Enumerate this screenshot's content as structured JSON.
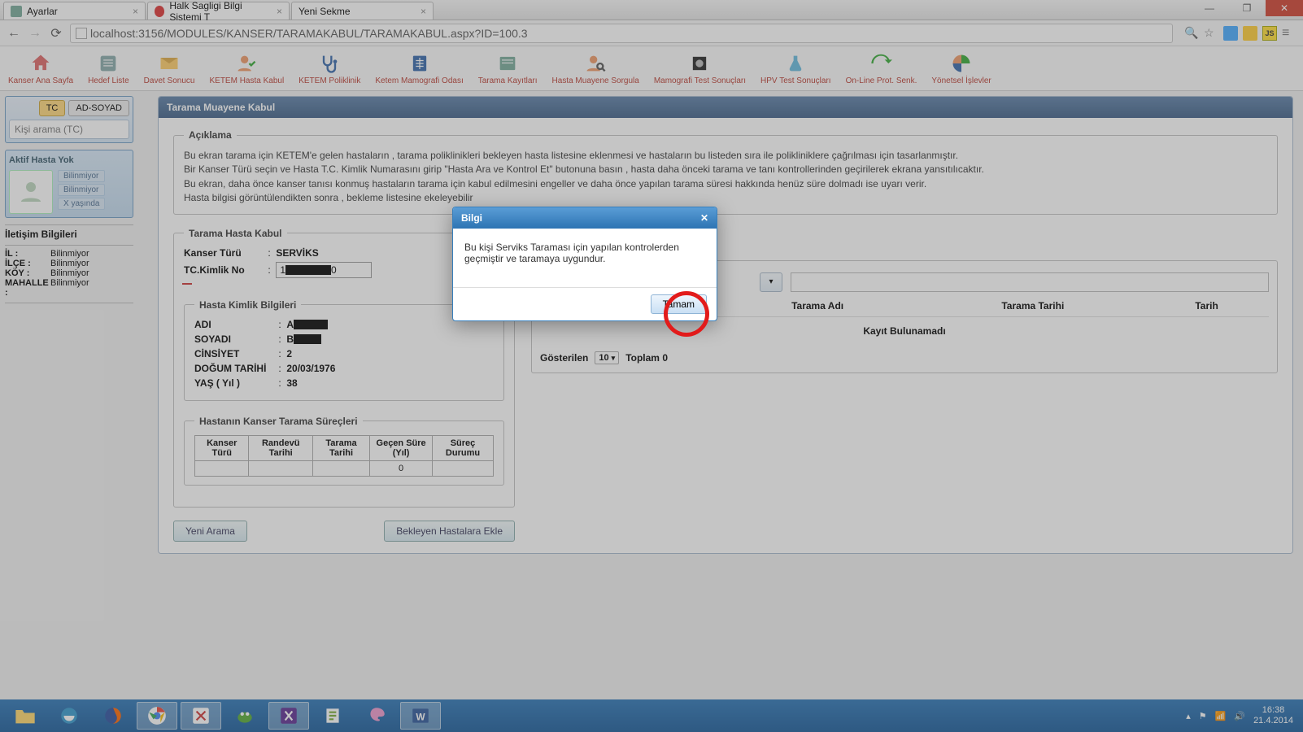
{
  "browser": {
    "tabs": [
      {
        "label": "Ayarlar"
      },
      {
        "label": "Halk Sagligi Bilgi Sistemi T"
      },
      {
        "label": "Yeni Sekme"
      }
    ],
    "active_tab_index": 1,
    "url": "localhost:3156/MODULES/KANSER/TARAMAKABUL/TARAMAKABUL.aspx?ID=100.3"
  },
  "toolbar": [
    {
      "label": "Kanser Ana Sayfa"
    },
    {
      "label": "Hedef Liste"
    },
    {
      "label": "Davet Sonucu"
    },
    {
      "label": "KETEM Hasta Kabul"
    },
    {
      "label": "KETEM Poliklinik"
    },
    {
      "label": "Ketem Mamografi Odası"
    },
    {
      "label": "Tarama Kayıtları"
    },
    {
      "label": "Hasta Muayene Sorgula"
    },
    {
      "label": "Mamografi Test Sonuçları"
    },
    {
      "label": "HPV Test Sonuçları"
    },
    {
      "label": "On-Line Prot. Senk."
    },
    {
      "label": "Yönetsel İşlevler"
    }
  ],
  "sidebar": {
    "tab_tc": "TC",
    "tab_adsoyad": "AD-SOYAD",
    "search_placeholder": "Kişi arama (TC)",
    "active_patient_label": "Aktif Hasta Yok",
    "info_lines": [
      "Bilinmiyor",
      "Bilinmiyor",
      "X yaşında"
    ],
    "contact_title": "İletişim Bilgileri",
    "contact": {
      "il_k": "İL :",
      "il_v": "Bilinmiyor",
      "ilce_k": "İLÇE :",
      "ilce_v": "Bilinmiyor",
      "koy_k": "KÖY :",
      "koy_v": "Bilinmiyor",
      "mah_k": "MAHALLE :",
      "mah_v": "Bilinmiyor"
    }
  },
  "panel": {
    "title": "Tarama Muayene Kabul",
    "aciklama_legend": "Açıklama",
    "aciklama_lines": [
      "Bu ekran tarama için KETEM'e gelen hastaların , tarama poliklinikleri bekleyen hasta listesine eklenmesi ve hastaların bu listeden sıra ile polikliniklere çağrılması için tasarlanmıştır.",
      "Bir Kanser Türü seçin ve Hasta T.C. Kimlik Numarasını girip \"Hasta Ara ve Kontrol Et\" butonuna basın , hasta daha önceki tarama ve tanı kontrollerinden geçirilerek ekrana yansıtılıcaktır.",
      "Bu ekran, daha önce kanser tanısı konmuş hastaların tarama için kabul edilmesini engeller ve daha önce yapılan tarama süresi hakkında henüz süre dolmadı ise uyarı verir.",
      "",
      "Hasta bilgisi görüntülendikten sonra , bekleme listesine ekeleyebilir"
    ],
    "kabul_legend": "Tarama Hasta Kabul",
    "kanser_turu_k": "Kanser Türü",
    "kanser_turu_v": "SERVİKS",
    "tc_k": "TC.Kimlik No",
    "tc_prefix": "1",
    "tc_suffix": "0",
    "kimlik_legend": "Hasta Kimlik Bilgileri",
    "kimlik": {
      "adi_k": "ADI",
      "adi_vprefix": "A",
      "soyadi_k": "SOYADI",
      "soyadi_vprefix": "B",
      "cinsiyet_k": "CİNSİYET",
      "cinsiyet_v": "2",
      "dtarihi_k": "DOĞUM TARİHİ",
      "dtarihi_v": "20/03/1976",
      "yas_k": "YAŞ ( Yıl )",
      "yas_v": "38"
    },
    "surec_legend": "Hastanın Kanser Tarama Süreçleri",
    "surec_headers": [
      "Kanser Türü",
      "Randevü Tarihi",
      "Tarama Tarihi",
      "Geçen Süre (Yıl)",
      "Süreç Durumu"
    ],
    "surec_row_gecen": "0",
    "yeni_arama_btn": "Yeni Arama",
    "bekleyen_ekle_btn": "Bekleyen Hastalara Ekle",
    "right_headers": [
      "Tarama Adı",
      "Tarama Tarihi",
      "Tarih"
    ],
    "kayit_yok": "Kayıt Bulunamadı",
    "gosterilen": "Gösterilen",
    "gosterilen_val": "10",
    "toplam": "Toplam 0"
  },
  "dialog": {
    "title": "Bilgi",
    "body": "Bu kişi Serviks Taraması için yapılan kontrolerden geçmiştir ve taramaya uygundur.",
    "ok": "Tamam"
  },
  "tray": {
    "time": "16:38",
    "date": "21.4.2014"
  }
}
